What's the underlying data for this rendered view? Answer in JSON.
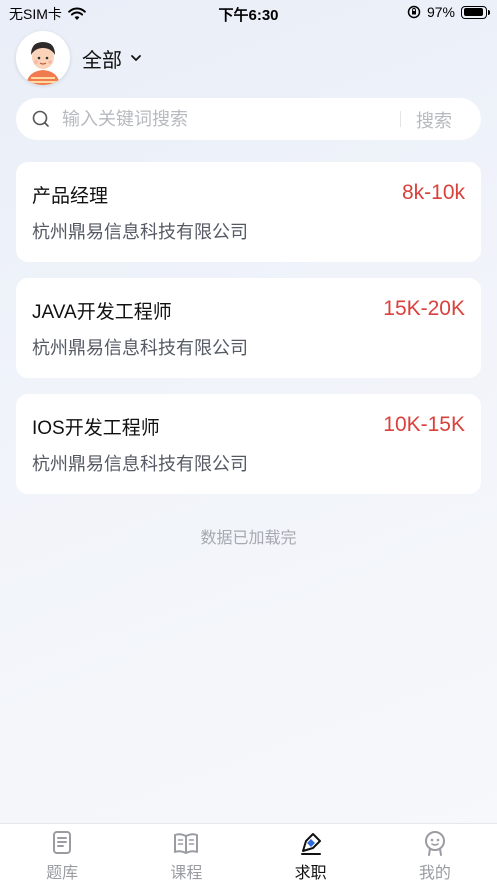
{
  "status_bar": {
    "carrier": "无SIM卡",
    "time": "下午6:30",
    "battery": "97%"
  },
  "header": {
    "filter_label": "全部"
  },
  "search": {
    "placeholder": "输入关键词搜索",
    "button_label": "搜索"
  },
  "jobs": [
    {
      "title": "产品经理",
      "salary": "8k-10k",
      "company": "杭州鼎易信息科技有限公司"
    },
    {
      "title": "JAVA开发工程师",
      "salary": "15K-20K",
      "company": "杭州鼎易信息科技有限公司"
    },
    {
      "title": "IOS开发工程师",
      "salary": "10K-15K",
      "company": "杭州鼎易信息科技有限公司"
    }
  ],
  "loaded_text": "数据已加载完",
  "tabs": [
    {
      "label": "题库",
      "icon": "question-bank-icon",
      "active": false
    },
    {
      "label": "课程",
      "icon": "book-icon",
      "active": false
    },
    {
      "label": "求职",
      "icon": "job-pen-icon",
      "active": true
    },
    {
      "label": "我的",
      "icon": "profile-icon",
      "active": false
    }
  ],
  "colors": {
    "salary": "#d9413d",
    "accent": "#2f6bdb",
    "inactive_tab": "#9a9ca2"
  }
}
